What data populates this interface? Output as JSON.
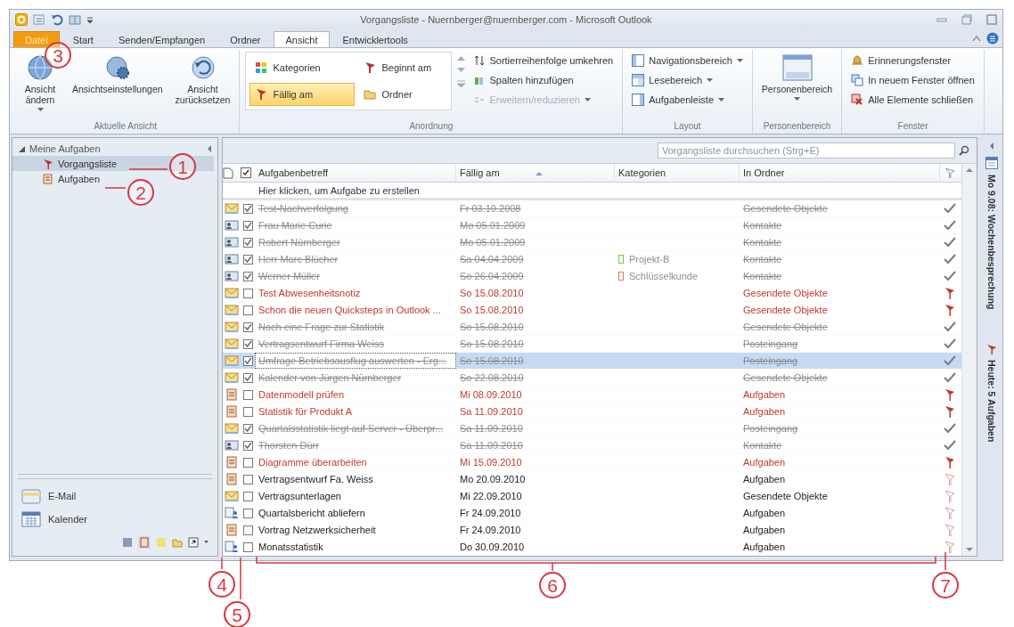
{
  "window": {
    "title": "Vorgangsliste - Nuernberger@nuernberger.com - Microsoft Outlook"
  },
  "tabs": [
    {
      "label": "Datei",
      "kind": "file",
      "selected": false
    },
    {
      "label": "Start",
      "kind": "tab",
      "selected": false
    },
    {
      "label": "Senden/Empfangen",
      "kind": "tab",
      "selected": false
    },
    {
      "label": "Ordner",
      "kind": "tab",
      "selected": false
    },
    {
      "label": "Ansicht",
      "kind": "tab",
      "selected": true
    },
    {
      "label": "Entwicklertools",
      "kind": "tab",
      "selected": false
    }
  ],
  "ribbon": {
    "groups": [
      {
        "label": "Aktuelle Ansicht",
        "items": [
          {
            "kind": "large",
            "label": "Ansicht ändern",
            "dropdown": true
          },
          {
            "kind": "large",
            "label": "Ansichtseinstellungen",
            "dropdown": false
          },
          {
            "kind": "large",
            "label": "Ansicht zurücksetzen",
            "dropdown": false
          }
        ]
      },
      {
        "label": "Anordnung",
        "items": [
          {
            "kind": "tile",
            "label": "Kategorien",
            "selected": false
          },
          {
            "kind": "tile",
            "label": "Beginnt am",
            "selected": false
          },
          {
            "kind": "tile",
            "label": "Fällig am",
            "selected": true
          },
          {
            "kind": "tile",
            "label": "Ordner",
            "selected": false
          },
          {
            "kind": "small",
            "label": "Sortierreihenfolge umkehren",
            "disabled": false,
            "dropdown": false
          },
          {
            "kind": "small",
            "label": "Spalten hinzufügen",
            "disabled": false,
            "dropdown": false
          },
          {
            "kind": "small",
            "label": "Erweitern/reduzieren",
            "disabled": true,
            "dropdown": true
          }
        ]
      },
      {
        "label": "Layout",
        "items": [
          {
            "kind": "small",
            "label": "Navigationsbereich",
            "disabled": false,
            "dropdown": true
          },
          {
            "kind": "small",
            "label": "Lesebereich",
            "disabled": false,
            "dropdown": true
          },
          {
            "kind": "small",
            "label": "Aufgabenleiste",
            "disabled": false,
            "dropdown": true
          }
        ]
      },
      {
        "label": "Personenbereich",
        "items": [
          {
            "kind": "large",
            "label": "Personenbereich",
            "dropdown": true
          }
        ]
      },
      {
        "label": "Fenster",
        "items": [
          {
            "kind": "small",
            "label": "Erinnerungsfenster",
            "disabled": false,
            "dropdown": false
          },
          {
            "kind": "small",
            "label": "In neuem Fenster öffnen",
            "disabled": false,
            "dropdown": false
          },
          {
            "kind": "small",
            "label": "Alle Elemente schließen",
            "disabled": false,
            "dropdown": false
          }
        ]
      }
    ]
  },
  "nav": {
    "header": {
      "label": "Meine Aufgaben",
      "expanded": true
    },
    "items": [
      {
        "label": "Vorgangsliste",
        "selected": true
      },
      {
        "label": "Aufgaben",
        "selected": false
      }
    ],
    "modules": [
      {
        "label": "E-Mail"
      },
      {
        "label": "Kalender"
      }
    ]
  },
  "tasks": {
    "search": {
      "placeholder": "Vorgangsliste durchsuchen (Strg+E)"
    },
    "columns": [
      {
        "label": "Aufgabenbetreff",
        "sorted": false
      },
      {
        "label": "Fällig am",
        "sorted": true
      },
      {
        "label": "Kategorien",
        "sorted": false
      },
      {
        "label": "In Ordner",
        "sorted": false
      }
    ],
    "new_task_prompt": "Hier klicken, um Aufgabe zu erstellen",
    "rows": [
      {
        "kind": "mail",
        "checked": true,
        "overdue": false,
        "selected": false,
        "subject": "Test-Nachverfolgung",
        "due": "Fr 03.10.2008",
        "folder": "Gesendete Objekte"
      },
      {
        "kind": "contact",
        "checked": true,
        "overdue": false,
        "selected": false,
        "subject": "Frau Marie Curie",
        "due": "Mo 05.01.2009",
        "folder": "Kontakte"
      },
      {
        "kind": "contact",
        "checked": true,
        "overdue": false,
        "selected": false,
        "subject": "Robert Nürnberger",
        "due": "Mo 05.01.2009",
        "folder": "Kontakte"
      },
      {
        "kind": "contact",
        "checked": true,
        "overdue": false,
        "selected": false,
        "subject": "Herr Marc Blücher",
        "due": "Sa 04.04.2009",
        "category": {
          "label": "Projekt-B",
          "color": "#7cc242"
        },
        "folder": "Kontakte"
      },
      {
        "kind": "contact",
        "checked": true,
        "overdue": false,
        "selected": false,
        "subject": "Werner Müller",
        "due": "So 26.04.2009",
        "category": {
          "label": "Schlüsselkunde",
          "color": "#e07a5a"
        },
        "folder": "Kontakte"
      },
      {
        "kind": "mail",
        "checked": false,
        "overdue": true,
        "selected": false,
        "subject": "Test Abwesenheitsnotiz",
        "due": "So 15.08.2010",
        "folder": "Gesendete Objekte"
      },
      {
        "kind": "mail",
        "checked": false,
        "overdue": true,
        "selected": false,
        "subject": "Schon die neuen Quicksteps in Outlook ...",
        "due": "So 15.08.2010",
        "folder": "Gesendete Objekte"
      },
      {
        "kind": "mail",
        "checked": true,
        "overdue": false,
        "selected": false,
        "subject": "Noch eine Frage zur Statistik",
        "due": "So 15.08.2010",
        "folder": "Gesendete Objekte"
      },
      {
        "kind": "mail",
        "checked": true,
        "overdue": false,
        "selected": false,
        "subject": "Vertragsentwurf Firma Weiss",
        "due": "So 15.08.2010",
        "folder": "Posteingang"
      },
      {
        "kind": "mail",
        "checked": true,
        "overdue": false,
        "selected": true,
        "subject": "Umfrage Betriebsausflug auswerten - Erg...",
        "due": "So 15.08.2010",
        "folder": "Posteingang"
      },
      {
        "kind": "mail",
        "checked": true,
        "overdue": false,
        "selected": false,
        "subject": "Kalender von Jürgen Nürnberger",
        "due": "So 22.08.2010",
        "folder": "Gesendete Objekte"
      },
      {
        "kind": "task",
        "checked": false,
        "overdue": true,
        "selected": false,
        "subject": "Datenmodell prüfen",
        "due": "Mi 08.09.2010",
        "folder": "Aufgaben"
      },
      {
        "kind": "task",
        "checked": false,
        "overdue": true,
        "selected": false,
        "subject": "Statistik für Produkt A",
        "due": "Sa 11.09.2010",
        "folder": "Aufgaben"
      },
      {
        "kind": "mail",
        "checked": true,
        "overdue": false,
        "selected": false,
        "subject": "Quartalsstatistik liegt auf Server - Überpr...",
        "due": "Sa 11.09.2010",
        "folder": "Posteingang"
      },
      {
        "kind": "contact",
        "checked": true,
        "overdue": false,
        "selected": false,
        "subject": "Thorsten Dürr",
        "due": "Sa 11.09.2010",
        "folder": "Kontakte"
      },
      {
        "kind": "task",
        "checked": false,
        "overdue": true,
        "selected": false,
        "subject": "Diagramme überarbeiten",
        "due": "Mi 15.09.2010",
        "folder": "Aufgaben"
      },
      {
        "kind": "task",
        "checked": false,
        "overdue": false,
        "selected": false,
        "subject": "Vertragsentwurf Fa. Weiss",
        "due": "Mo 20.09.2010",
        "folder": "Aufgaben"
      },
      {
        "kind": "mail",
        "checked": false,
        "overdue": false,
        "selected": false,
        "subject": "Vertragsunterlagen",
        "due": "Mi 22.09.2010",
        "folder": "Gesendete Objekte"
      },
      {
        "kind": "assigned",
        "checked": false,
        "overdue": false,
        "selected": false,
        "subject": "Quartalsbericht abliefern",
        "due": "Fr 24.09.2010",
        "folder": "Aufgaben"
      },
      {
        "kind": "task",
        "checked": false,
        "overdue": false,
        "selected": false,
        "subject": "Vortrag Netzwerksicherheit",
        "due": "Fr 24.09.2010",
        "folder": "Aufgaben"
      },
      {
        "kind": "assigned",
        "checked": false,
        "overdue": false,
        "selected": false,
        "subject": "Monatsstatistik",
        "due": "Do 30.09.2010",
        "folder": "Aufgaben"
      }
    ]
  },
  "todo_bar": {
    "items": [
      {
        "label": "Mo 9.08: Wochenbesprechung"
      },
      {
        "label": "Heute: 5 Aufgaben"
      }
    ]
  },
  "callouts": [
    {
      "number": "1"
    },
    {
      "number": "2"
    },
    {
      "number": "3"
    },
    {
      "number": "4"
    },
    {
      "number": "5"
    },
    {
      "number": "6"
    },
    {
      "number": "7"
    }
  ]
}
